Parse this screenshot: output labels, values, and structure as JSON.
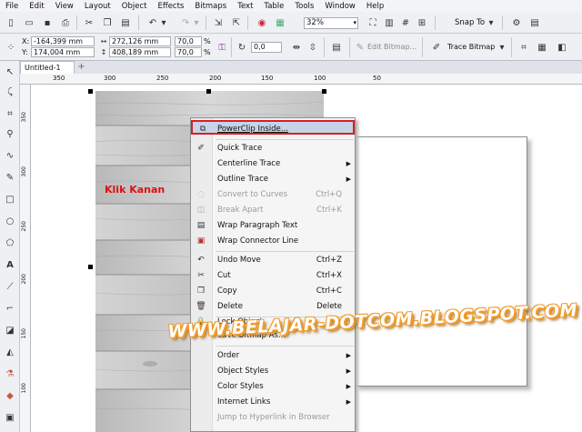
{
  "menubar": {
    "items": [
      "File",
      "Edit",
      "View",
      "Layout",
      "Object",
      "Effects",
      "Bitmaps",
      "Text",
      "Table",
      "Tools",
      "Window",
      "Help"
    ]
  },
  "toolbar": {
    "zoom": "32%",
    "snap_to": "Snap To"
  },
  "property_bar": {
    "x_label": "X:",
    "x_value": "-164,399 mm",
    "y_label": "Y:",
    "y_value": "174,004 mm",
    "w_value": "272,126 mm",
    "h_value": "408,189 mm",
    "scale_x": "70,0",
    "scale_y": "70,0",
    "pct": "%",
    "rotation": "0,0",
    "edit_bitmap": "Edit Bitmap...",
    "trace_bitmap": "Trace Bitmap"
  },
  "document_tab": "Untitled-1",
  "ruler_h": [
    "350",
    "300",
    "250",
    "200",
    "150",
    "100",
    "50"
  ],
  "ruler_v": [
    "350",
    "300",
    "250",
    "200",
    "150",
    "100"
  ],
  "annotation": "Klik Kanan",
  "watermark": "WWW.BELAJAR-DOTCOM.BLOGSPOT.COM",
  "context_menu": {
    "items": [
      {
        "label": "PowerClip Inside...",
        "icon": "powerclip-icon",
        "highlighted": true
      },
      {
        "label": "Quick Trace",
        "icon": "quick-trace-icon"
      },
      {
        "label": "Centerline Trace",
        "submenu": true
      },
      {
        "label": "Outline Trace",
        "submenu": true
      },
      {
        "label": "Convert to Curves",
        "shortcut": "Ctrl+Q",
        "disabled": true
      },
      {
        "label": "Break Apart",
        "shortcut": "Ctrl+K",
        "disabled": true
      },
      {
        "label": "Wrap Paragraph Text",
        "icon": "wrap-text-icon"
      },
      {
        "label": "Wrap Connector Line",
        "icon": "wrap-connector-icon"
      },
      {
        "label": "Undo Move",
        "shortcut": "Ctrl+Z",
        "icon": "undo-icon"
      },
      {
        "label": "Cut",
        "shortcut": "Ctrl+X",
        "icon": "cut-icon"
      },
      {
        "label": "Copy",
        "shortcut": "Ctrl+C",
        "icon": "copy-icon"
      },
      {
        "label": "Delete",
        "shortcut": "Delete",
        "icon": "delete-icon"
      },
      {
        "label": "Lock Object",
        "icon": "lock-icon"
      },
      {
        "label": "Save Bitmap As..."
      },
      {
        "label": "Order",
        "submenu": true
      },
      {
        "label": "Object Styles",
        "submenu": true
      },
      {
        "label": "Color Styles",
        "submenu": true
      },
      {
        "label": "Internet Links",
        "submenu": true
      },
      {
        "label": "Jump to Hyperlink in Browser",
        "disabled": true
      }
    ]
  }
}
